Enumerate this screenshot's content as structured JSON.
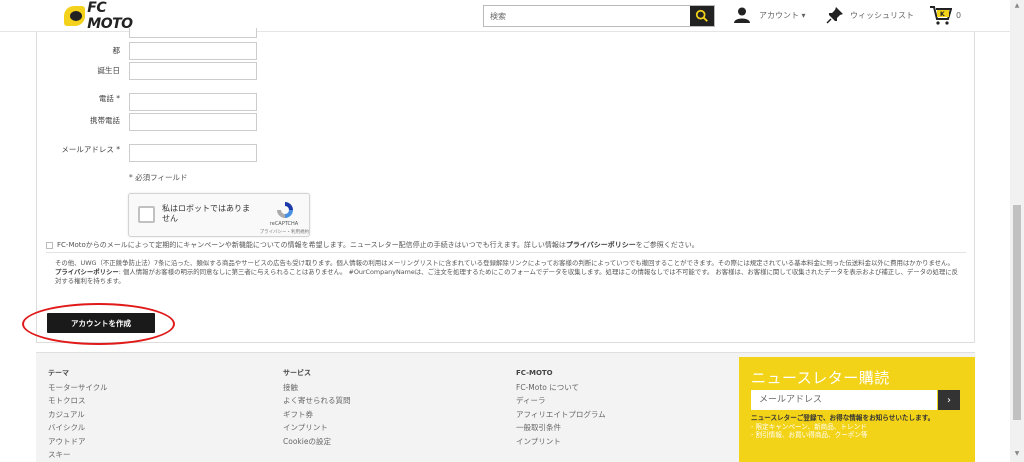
{
  "header": {
    "logo_text": "FC MOTO",
    "search_placeholder": "検索",
    "account_label": "アカウント ▾",
    "wishlist_label": "ウィッシュリスト",
    "cart_count": "0"
  },
  "form": {
    "fields": [
      {
        "label": "都",
        "value": ""
      },
      {
        "label": "誕生日",
        "value": ""
      },
      {
        "label": "電話 *",
        "value": ""
      },
      {
        "label": "携帯電話",
        "value": ""
      },
      {
        "label": "メールアドレス *",
        "value": ""
      }
    ],
    "required_note": "* 必須フィールド",
    "recaptcha": {
      "label": "私はロボットではありません",
      "brand": "reCAPTCHA",
      "links": "プライバシー・利用規約"
    },
    "newsletter_optin_pre": "FC-Motoからのメールによって定期的にキャンペーンや新機能についての情報を希望します。ニュースレター配信停止の手続きはいつでも行えます。詳しい情報は",
    "newsletter_optin_link": "プライバシーポリシー",
    "newsletter_optin_post": "をご参照ください。",
    "legal_1": "その他、UWG（不正競争防止法）7条に沿った、類似する商品やサービスの広告も受け取ります。個人情報の利用はメーリングリストに含まれている登録解除リンクによってお客様の判断によっていつでも撤回することができます。その際には規定されている基本料金に則った伝送料金以外に費用はかかりません。",
    "legal_2_head": "プライバシーポリシー",
    "legal_2": ": 個人情報がお客様の明示的同意なしに第三者に与えられることはありません。 #OurCompanyNameは、ご注文を処理するためにこのフォームでデータを収集します。処理はこの情報なしでは不可能です。 お客様は、お客様に関して収集されたデータを表示および補正し、データの処理に反対する権利を持ちます。",
    "create_button": "アカウントを作成"
  },
  "footer": {
    "columns": [
      {
        "heading": "テーマ",
        "items": [
          "モーターサイクル",
          "モトクロス",
          "カジュアル",
          "バイシクル",
          "アウトドア",
          "スキー"
        ]
      },
      {
        "heading": "サービス",
        "items": [
          "接触",
          "よく寄せられる質問",
          "ギフト券",
          "インプリント",
          "Cookieの設定"
        ]
      },
      {
        "heading": "FC-MOTO",
        "items": [
          "FC-Moto について",
          "ディーラ",
          "アフィリエイトプログラム",
          "一般取引条件",
          "インプリント"
        ]
      }
    ],
    "newsletter": {
      "title": "ニュースレター購読",
      "placeholder": "メールアドレス",
      "go": "›",
      "lead": "ニュースレターご登録で、お得な情報をお知らせいたします。",
      "bullets": [
        "- 限定キャンペーン、新商品、トレンド",
        "- 割引情報、お買い得商品、クーポン等"
      ]
    }
  },
  "colors": {
    "brand_yellow": "#f2d318",
    "button_dark": "#1a1a1a",
    "annotation_red": "#e01a1a"
  }
}
